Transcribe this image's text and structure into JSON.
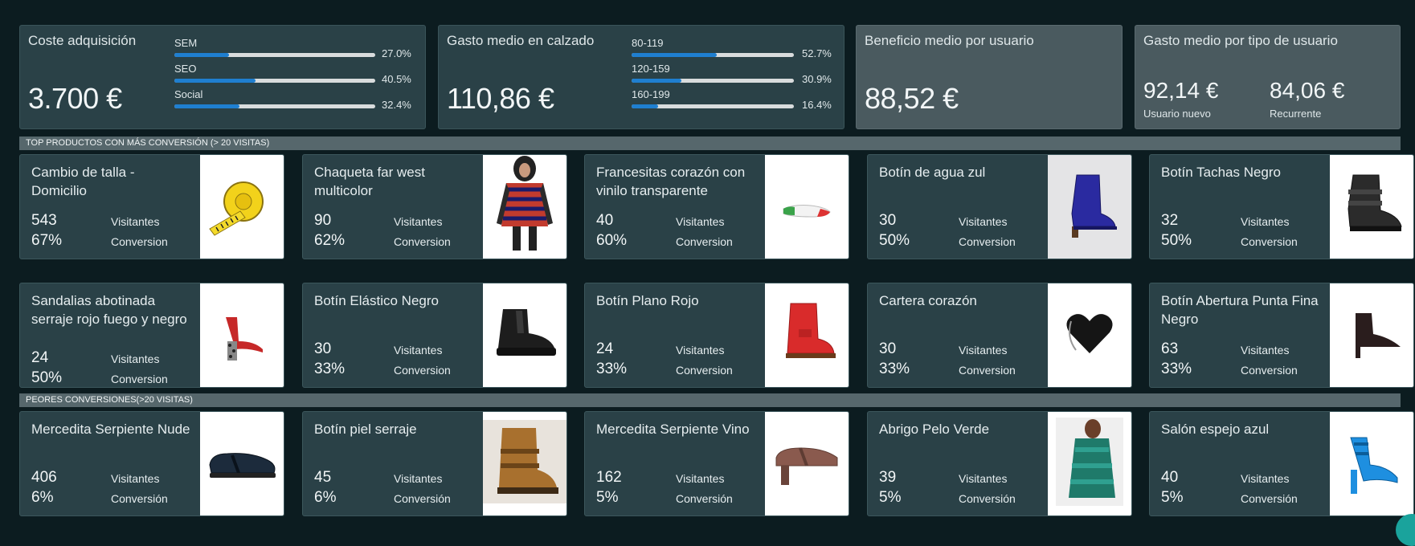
{
  "kpis": {
    "acquisition": {
      "title": "Coste adquisición",
      "value": "3.700 €",
      "bars": [
        {
          "label": "SEM",
          "pct_text": "27.0%",
          "pct": 27.0
        },
        {
          "label": "SEO",
          "pct_text": "40.5%",
          "pct": 40.5
        },
        {
          "label": "Social",
          "pct_text": "32.4%",
          "pct": 32.4
        }
      ]
    },
    "footwear": {
      "title": "Gasto medio en calzado",
      "value": "110,86 €",
      "bars": [
        {
          "label": "80-119",
          "pct_text": "52.7%",
          "pct": 52.7
        },
        {
          "label": "120-159",
          "pct_text": "30.9%",
          "pct": 30.9
        },
        {
          "label": "160-199",
          "pct_text": "16.4%",
          "pct": 16.4
        }
      ]
    },
    "profit": {
      "title": "Beneficio medio por usuario",
      "value": "88,52 €"
    },
    "user_type": {
      "title": "Gasto medio por tipo de usuario",
      "new_value": "92,14 €",
      "new_label": "Usuario nuevo",
      "returning_value": "84,06 €",
      "returning_label": "Recurrente"
    }
  },
  "sections": {
    "top": "TOP PRODUCTOS CON MÁS CONVERSIÓN (> 20 VISITAS)",
    "worst": "PEORES CONVERSIONES(>20 VISITAS)"
  },
  "top_products": [
    {
      "name": "Cambio de talla - Domicilio",
      "visits": "543",
      "conv": "67%",
      "visits_label": "Visitantes",
      "conv_label": "Conversion",
      "image": "measuring-tape-icon"
    },
    {
      "name": "Chaqueta far west multicolor",
      "visits": "90",
      "conv": "62%",
      "visits_label": "Visitantes",
      "conv_label": "Conversion",
      "image": "jacket-icon"
    },
    {
      "name": "Francesitas corazón con vinilo transparente",
      "visits": "40",
      "conv": "60%",
      "visits_label": "Visitantes",
      "conv_label": "Conversion",
      "image": "flat-shoe-icon"
    },
    {
      "name": "Botín de agua zul",
      "visits": "30",
      "conv": "50%",
      "visits_label": "Visitantes",
      "conv_label": "Conversion",
      "image": "blue-boot-icon"
    },
    {
      "name": "Botín Tachas Negro",
      "visits": "32",
      "conv": "50%",
      "visits_label": "Visitantes",
      "conv_label": "Conversion",
      "image": "black-buckle-boot-icon"
    },
    {
      "name": "Sandalias abotinada serraje rojo fuego y negro",
      "visits": "24",
      "conv": "50%",
      "visits_label": "Visitantes",
      "conv_label": "Conversion",
      "image": "red-sandal-icon"
    },
    {
      "name": "Botín Elástico Negro",
      "visits": "30",
      "conv": "33%",
      "visits_label": "Visitantes",
      "conv_label": "Conversion",
      "image": "chelsea-boot-icon"
    },
    {
      "name": "Botín Plano Rojo",
      "visits": "24",
      "conv": "33%",
      "visits_label": "Visitantes",
      "conv_label": "Conversion",
      "image": "red-boot-icon"
    },
    {
      "name": "Cartera corazón",
      "visits": "30",
      "conv": "33%",
      "visits_label": "Visitantes",
      "conv_label": "Conversion",
      "image": "heart-purse-icon"
    },
    {
      "name": "Botín Abertura Punta Fina Negro",
      "visits": "63",
      "conv": "33%",
      "visits_label": "Visitantes",
      "conv_label": "Conversion",
      "image": "pointed-bootie-icon"
    }
  ],
  "worst_products": [
    {
      "name": "Mercedita Serpiente Nude",
      "visits": "406",
      "conv": "6%",
      "visits_label": "Visitantes",
      "conv_label": "Conversión",
      "image": "mary-jane-shoe-icon"
    },
    {
      "name": "Botín piel serraje",
      "visits": "45",
      "conv": "6%",
      "visits_label": "Visitantes",
      "conv_label": "Conversión",
      "image": "suede-boot-icon"
    },
    {
      "name": "Mercedita Serpiente Vino",
      "visits": "162",
      "conv": "5%",
      "visits_label": "Visitantes",
      "conv_label": "Conversión",
      "image": "wine-mary-jane-icon"
    },
    {
      "name": "Abrigo Pelo Verde",
      "visits": "39",
      "conv": "5%",
      "visits_label": "Visitantes",
      "conv_label": "Conversión",
      "image": "green-fur-coat-icon"
    },
    {
      "name": "Salón espejo azul",
      "visits": "40",
      "conv": "5%",
      "visits_label": "Visitantes",
      "conv_label": "Conversión",
      "image": "blue-heel-icon"
    }
  ]
}
